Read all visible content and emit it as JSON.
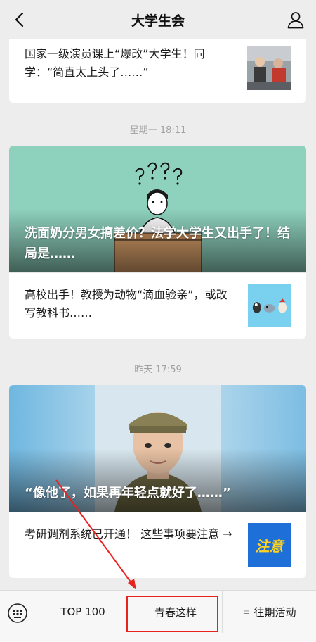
{
  "header": {
    "title": "大学生会",
    "back_icon": "chevron-left-icon",
    "user_icon": "person-icon"
  },
  "articles": {
    "a1": {
      "title": "国家一级演员课上“爆改”大学生！同学：“简直太上头了……”"
    },
    "ts1": "星期一 18:11",
    "a2": {
      "title": "洗面奶分男女搞差价？法学大学生又出手了！结局是……"
    },
    "a3": {
      "title": "高校出手！教授为动物“滴血验亲”，或改写教科书……"
    },
    "ts2": "昨天 17:59",
    "a4": {
      "title": "“像他了，如果再年轻点就好了……”"
    },
    "a5": {
      "title": "考研调剂系统已开通！ 这些事项要注意 →",
      "thumb_text": "注意"
    }
  },
  "bottom_menu": {
    "keyboard_icon": "keyboard-icon",
    "m1": "TOP 100",
    "m2": "青春这样",
    "m3": "往期活动",
    "m3_icon": "≡"
  },
  "annotation_color": "#e8231f"
}
